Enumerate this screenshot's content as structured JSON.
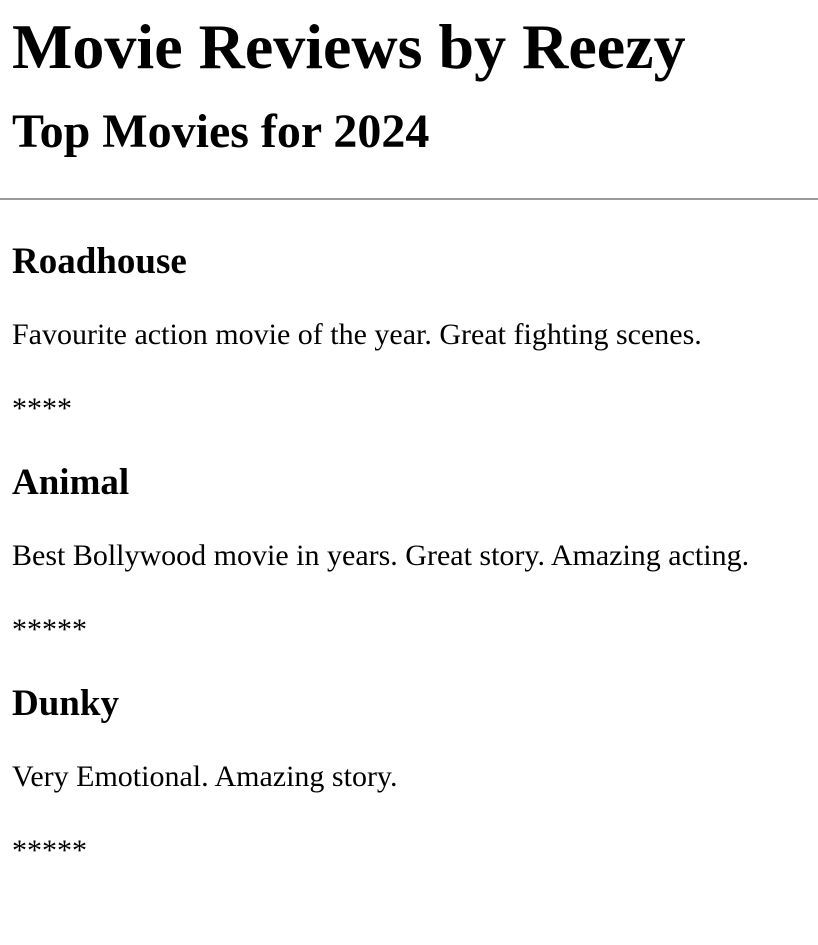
{
  "page": {
    "title": "Movie Reviews by Reezy",
    "subtitle": "Top Movies for 2024"
  },
  "reviews": [
    {
      "title": "Roadhouse",
      "description": "Favourite action movie of the year. Great fighting scenes.",
      "rating": "****"
    },
    {
      "title": "Animal",
      "description": "Best Bollywood movie in years. Great story. Amazing acting.",
      "rating": "*****"
    },
    {
      "title": "Dunky",
      "description": "Very Emotional. Amazing story.",
      "rating": "*****"
    }
  ]
}
